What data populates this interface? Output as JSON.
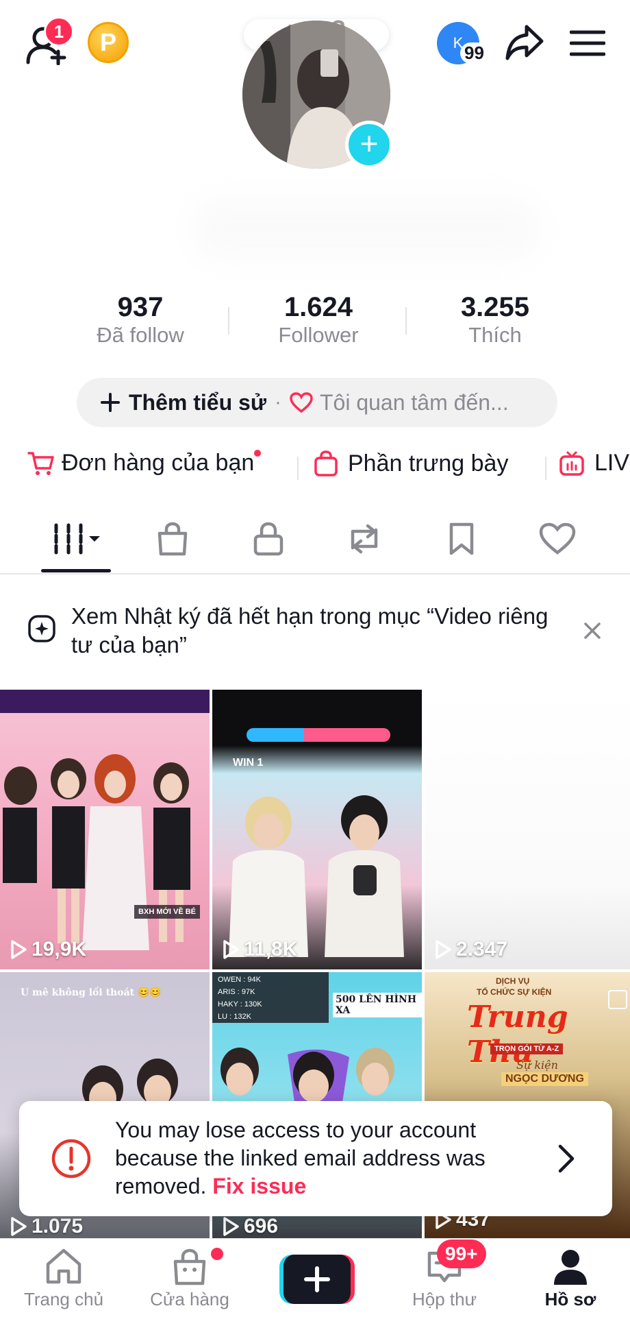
{
  "header": {
    "friend_badge": "1",
    "coin_letter": "P",
    "account_initial": "K",
    "account_count": "99",
    "note_text": "pne?"
  },
  "stats": [
    {
      "value": "937",
      "label": "Đã follow"
    },
    {
      "value": "1.624",
      "label": "Follower"
    },
    {
      "value": "3.255",
      "label": "Thích"
    }
  ],
  "bio": {
    "add_bio": "Thêm tiểu sử",
    "separator": "·",
    "interests": "Tôi quan tâm đến..."
  },
  "shortcuts": [
    {
      "label": "Đơn hàng của bạn",
      "icon": "cart-icon"
    },
    {
      "label": "Phần trưng bày",
      "icon": "shopping-bag-icon"
    },
    {
      "label": "LIV",
      "icon": "live-tv-icon"
    }
  ],
  "banner": {
    "text": "Xem Nhật ký đã hết hạn trong mục “Video riêng tư của bạn”"
  },
  "videos": [
    {
      "views": "19,9K",
      "overlay": "BXH MỚI VỀ BÉ"
    },
    {
      "views": "11,8K",
      "overlay": "WIN 1"
    },
    {
      "views": "2.347",
      "overlay": ""
    },
    {
      "views": "1.075",
      "overlay": "U mê không lối thoát 😊😊"
    },
    {
      "views": "696",
      "overlay": "500 LÊN HÌNH XA"
    },
    {
      "views": "437",
      "overlay": "Trung Thu"
    }
  ],
  "video_extra": {
    "v6_top": "DỊCH VỤ",
    "v6_sub": "TỔ CHỨC SỰ KIỆN",
    "v6_ribbon": "TRỌN GÓI TỪ A-Z",
    "v6_event": "Sự kiện",
    "v6_name": "NGỌC DƯƠNG",
    "v4_top": "OWEN : 94K",
    "v4_line2": "ARIS : 97K",
    "v4_line3": "HAKY : 130K",
    "v4_line4": "LU : 132K"
  },
  "toast": {
    "message": "You may lose access to your account because the linked email address was removed.",
    "link": "Fix issue"
  },
  "bottom_nav": [
    {
      "label": "Trang chủ",
      "icon": "home-icon"
    },
    {
      "label": "Cửa hàng",
      "icon": "shop-icon"
    },
    {
      "label": "",
      "icon": "create-plus-icon"
    },
    {
      "label": "Hộp thư",
      "icon": "inbox-icon",
      "badge": "99+"
    },
    {
      "label": "Hồ sơ",
      "icon": "profile-icon"
    }
  ],
  "colors": {
    "accent": "#fe2c55",
    "cyan": "#20d5ec",
    "text": "#161823",
    "muted": "#8a8b91"
  }
}
